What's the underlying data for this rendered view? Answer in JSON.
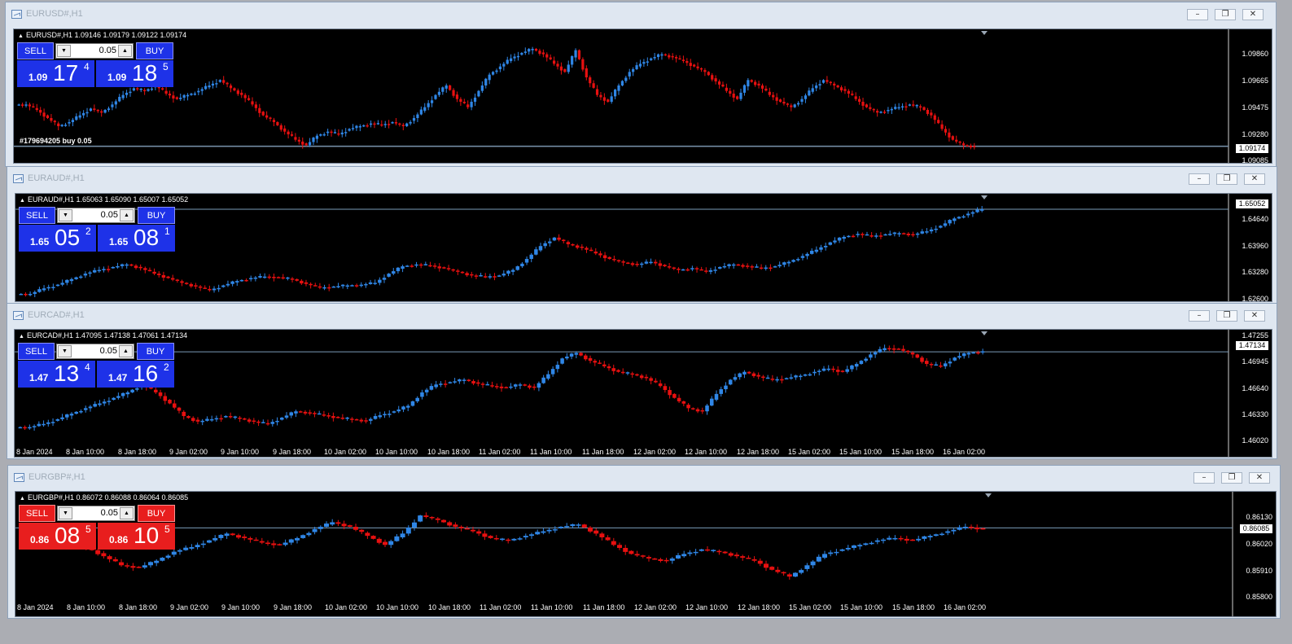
{
  "windows": [
    {
      "key": "eurusd",
      "title": "EURUSD#,H1",
      "info": "EURUSD#,H1  1.09146 1.09179 1.09122 1.09174",
      "theme": "blue",
      "sell_label": "SELL",
      "buy_label": "BUY",
      "lot": "0.05",
      "bid_small": "1.09",
      "bid_big": "17",
      "bid_sup": "4",
      "ask_small": "1.09",
      "ask_big": "18",
      "ask_sup": "5",
      "current_price": "1.09174",
      "order_label": "#179694205 buy 0.05",
      "price_labels": [
        "1.09860",
        "1.09665",
        "1.09475",
        "1.09280",
        "1.09085"
      ],
      "time_labels": []
    },
    {
      "key": "euraud",
      "title": "EURAUD#,H1",
      "info": "EURAUD#,H1  1.65063 1.65090 1.65007 1.65052",
      "theme": "blue",
      "sell_label": "SELL",
      "buy_label": "BUY",
      "lot": "0.05",
      "bid_small": "1.65",
      "bid_big": "05",
      "bid_sup": "2",
      "ask_small": "1.65",
      "ask_big": "08",
      "ask_sup": "1",
      "current_price": "1.65052",
      "order_label": "",
      "price_labels": [
        "1.64640",
        "1.63960",
        "1.63280",
        "1.62600"
      ],
      "time_labels": []
    },
    {
      "key": "eurcad",
      "title": "EURCAD#,H1",
      "info": "EURCAD#,H1  1.47095 1.47138 1.47061 1.47134",
      "theme": "blue",
      "sell_label": "SELL",
      "buy_label": "BUY",
      "lot": "0.05",
      "bid_small": "1.47",
      "bid_big": "13",
      "bid_sup": "4",
      "ask_small": "1.47",
      "ask_big": "16",
      "ask_sup": "2",
      "current_price": "1.47134",
      "order_label": "",
      "price_labels": [
        "1.47255",
        "1.46945",
        "1.46640",
        "1.46330",
        "1.46020"
      ],
      "time_labels": [
        "8 Jan 2024",
        "8 Jan 10:00",
        "8 Jan 18:00",
        "9 Jan 02:00",
        "9 Jan 10:00",
        "9 Jan 18:00",
        "10 Jan 02:00",
        "10 Jan 10:00",
        "10 Jan 18:00",
        "11 Jan 02:00",
        "11 Jan 10:00",
        "11 Jan 18:00",
        "12 Jan 02:00",
        "12 Jan 10:00",
        "12 Jan 18:00",
        "15 Jan 02:00",
        "15 Jan 10:00",
        "15 Jan 18:00",
        "16 Jan 02:00"
      ]
    },
    {
      "key": "eurgbp",
      "title": "EURGBP#,H1",
      "info": "EURGBP#,H1  0.86072 0.86088 0.86064 0.86085",
      "theme": "red",
      "sell_label": "SELL",
      "buy_label": "BUY",
      "lot": "0.05",
      "bid_small": "0.86",
      "bid_big": "08",
      "bid_sup": "5",
      "ask_small": "0.86",
      "ask_big": "10",
      "ask_sup": "5",
      "current_price": "0.86085",
      "order_label": "",
      "price_labels": [
        "0.86130",
        "0.86020",
        "0.85910",
        "0.85800"
      ],
      "time_labels": [
        "8 Jan 2024",
        "8 Jan 10:00",
        "8 Jan 18:00",
        "9 Jan 02:00",
        "9 Jan 10:00",
        "9 Jan 18:00",
        "10 Jan 02:00",
        "10 Jan 10:00",
        "10 Jan 18:00",
        "11 Jan 02:00",
        "11 Jan 10:00",
        "11 Jan 18:00",
        "12 Jan 02:00",
        "12 Jan 10:00",
        "12 Jan 18:00",
        "15 Jan 02:00",
        "15 Jan 10:00",
        "15 Jan 18:00",
        "16 Jan 02:00"
      ]
    }
  ],
  "window_controls": {
    "minimize": "–",
    "restore": "❐",
    "close": "✕"
  },
  "colors": {
    "bull": "#2f86e6",
    "bear": "#e81010",
    "grid": "#4a5a6a"
  },
  "series": {
    "eurusd": [
      1.0948,
      1.0944,
      1.0938,
      1.0932,
      1.0935,
      1.094,
      1.0945,
      1.0942,
      1.0948,
      1.0955,
      1.096,
      1.0958,
      1.0962,
      1.0956,
      1.0952,
      1.0955,
      1.0958,
      1.0962,
      1.0966,
      1.096,
      1.0955,
      1.0948,
      1.094,
      1.0935,
      1.0928,
      1.0922,
      1.0918,
      1.0925,
      1.0928,
      1.0926,
      1.093,
      1.0932,
      1.0934,
      1.0933,
      1.0935,
      1.0932,
      1.0938,
      1.0946,
      1.0955,
      1.0962,
      1.0952,
      1.0946,
      1.0958,
      1.097,
      1.0976,
      1.0982,
      1.0986,
      1.0989,
      1.0985,
      1.0978,
      1.0972,
      1.0988,
      1.0968,
      1.0955,
      1.095,
      1.0962,
      1.0972,
      1.0978,
      1.0982,
      1.0985,
      1.0983,
      1.098,
      1.0976,
      1.0972,
      1.0965,
      1.0958,
      1.0952,
      1.0966,
      1.0962,
      1.0955,
      1.095,
      1.0946,
      1.0952,
      1.096,
      1.0966,
      1.0962,
      1.0958,
      1.0952,
      1.0946,
      1.0942,
      1.0944,
      1.0946,
      1.0948,
      1.0946,
      1.094,
      1.093,
      1.0922,
      1.0918,
      1.0917
    ],
    "euraud": [
      1.6275,
      1.629,
      1.63,
      1.6315,
      1.633,
      1.634,
      1.6348,
      1.6355,
      1.6345,
      1.633,
      1.6318,
      1.6305,
      1.6295,
      1.6285,
      1.6298,
      1.631,
      1.6318,
      1.6322,
      1.632,
      1.6315,
      1.6302,
      1.6292,
      1.6295,
      1.6298,
      1.63,
      1.6305,
      1.633,
      1.635,
      1.6355,
      1.6352,
      1.6345,
      1.6335,
      1.6325,
      1.6322,
      1.6325,
      1.634,
      1.637,
      1.6405,
      1.6428,
      1.641,
      1.64,
      1.6385,
      1.637,
      1.636,
      1.6355,
      1.6362,
      1.635,
      1.634,
      1.6345,
      1.6335,
      1.6348,
      1.6355,
      1.635,
      1.6345,
      1.635,
      1.6362,
      1.6378,
      1.6395,
      1.6415,
      1.643,
      1.6438,
      1.6432,
      1.6437,
      1.644,
      1.6436,
      1.6445,
      1.646,
      1.648,
      1.6493,
      1.6505
    ],
    "eurcad": [
      1.4618,
      1.4622,
      1.4628,
      1.4635,
      1.4642,
      1.4648,
      1.4655,
      1.4662,
      1.4672,
      1.4662,
      1.4648,
      1.4632,
      1.4625,
      1.4628,
      1.4632,
      1.4629,
      1.4625,
      1.4622,
      1.463,
      1.4638,
      1.4636,
      1.4633,
      1.463,
      1.4628,
      1.4626,
      1.4633,
      1.4638,
      1.4645,
      1.4662,
      1.4672,
      1.4675,
      1.4678,
      1.4673,
      1.467,
      1.4668,
      1.4672,
      1.4668,
      1.4685,
      1.4705,
      1.4712,
      1.4702,
      1.4695,
      1.4688,
      1.4685,
      1.468,
      1.467,
      1.4655,
      1.4642,
      1.4638,
      1.466,
      1.4678,
      1.4688,
      1.4682,
      1.4678,
      1.468,
      1.4683,
      1.4688,
      1.4692,
      1.4688,
      1.4698,
      1.471,
      1.4718,
      1.4717,
      1.471,
      1.4698,
      1.4695,
      1.4706,
      1.4712,
      1.4714
    ],
    "eurgbp": [
      0.8608,
      0.8607,
      0.8604,
      0.86,
      0.8596,
      0.8592,
      0.8591,
      0.8594,
      0.8598,
      0.86,
      0.8603,
      0.8606,
      0.8604,
      0.8602,
      0.8601,
      0.8604,
      0.8608,
      0.8611,
      0.8609,
      0.8605,
      0.8601,
      0.8606,
      0.8614,
      0.8612,
      0.8609,
      0.8607,
      0.8604,
      0.8603,
      0.8605,
      0.8607,
      0.8609,
      0.861,
      0.8606,
      0.8601,
      0.8597,
      0.8595,
      0.8594,
      0.8597,
      0.8599,
      0.8598,
      0.8596,
      0.8594,
      0.859,
      0.8587,
      0.8592,
      0.8597,
      0.8599,
      0.8601,
      0.8603,
      0.8604,
      0.8603,
      0.8605,
      0.8607,
      0.8609,
      0.8608
    ]
  },
  "ranges": {
    "eurusd": [
      1.0905,
      1.0995
    ],
    "euraud": [
      1.6255,
      1.6525
    ],
    "eurcad": [
      1.4597,
      1.4731
    ],
    "eurgbp": [
      0.8577,
      0.8618
    ]
  },
  "order_line": {
    "eurusd": 1.0917
  }
}
